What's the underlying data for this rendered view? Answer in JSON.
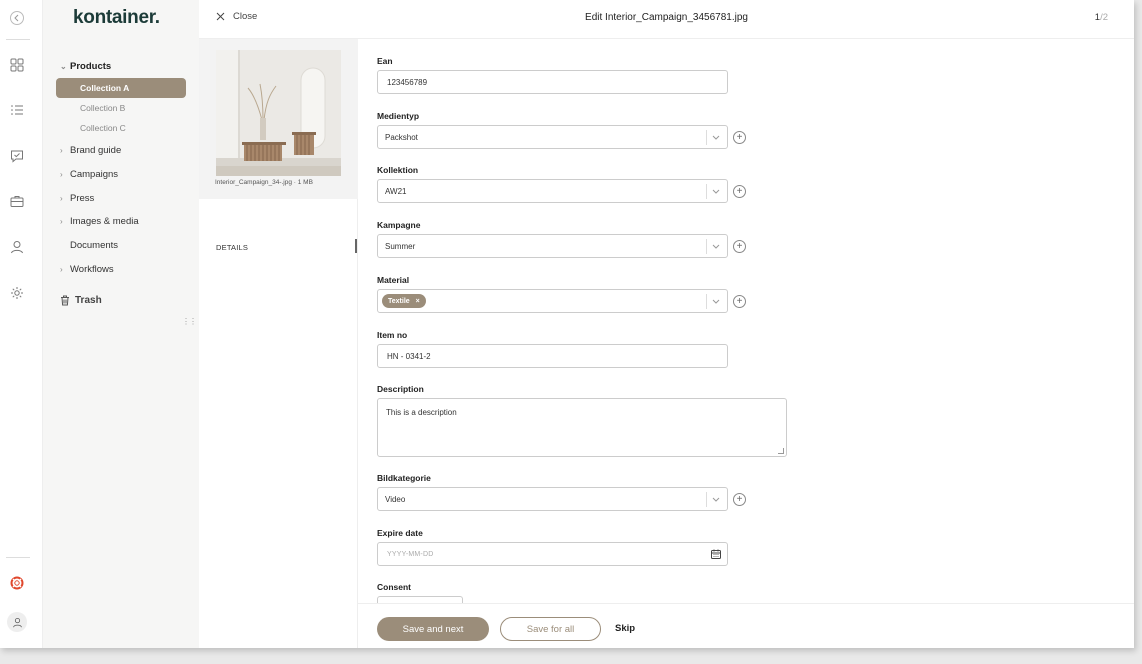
{
  "app": {
    "logo": "kontainer.",
    "brand_color": "#9b8d7a",
    "logo_color": "#1c3b38"
  },
  "rail": {
    "icons": [
      "grid-icon",
      "list-icon",
      "approval-icon",
      "briefcase-icon",
      "user-icon",
      "gear-icon"
    ],
    "bottom_icons": [
      "lifebuoy-icon",
      "account-icon"
    ]
  },
  "nav": {
    "products": "Products",
    "collections": [
      "Collection A",
      "Collection B",
      "Collection C"
    ],
    "items": [
      "Brand guide",
      "Campaigns",
      "Press",
      "Images & media",
      "Documents",
      "Workflows"
    ],
    "trash": "Trash"
  },
  "header": {
    "close_label": "Close",
    "title": "Edit Interior_Campaign_3456781.jpg",
    "page_current": "1",
    "page_total": "/2"
  },
  "preview": {
    "caption": "Interior_Campaign_34-.jpg · 1 MB",
    "details_tab": "DETAILS"
  },
  "form": {
    "ean": {
      "label": "Ean",
      "value": "123456789"
    },
    "medientyp": {
      "label": "Medientyp",
      "value": "Packshot"
    },
    "kollektion": {
      "label": "Kollektion",
      "value": "AW21"
    },
    "kampagne": {
      "label": "Kampagne",
      "value": "Summer"
    },
    "material": {
      "label": "Material",
      "chip": "Textile"
    },
    "item_no": {
      "label": "Item no",
      "value": "HN - 0341-2"
    },
    "description": {
      "label": "Description",
      "value": "This is a description"
    },
    "bildkategorie": {
      "label": "Bildkategorie",
      "value": "Video"
    },
    "expire_date": {
      "label": "Expire date",
      "placeholder": "YYYY-MM-DD"
    },
    "consent": {
      "label": "Consent"
    }
  },
  "footer": {
    "save_next": "Save and next",
    "save_all": "Save for all",
    "skip": "Skip"
  }
}
